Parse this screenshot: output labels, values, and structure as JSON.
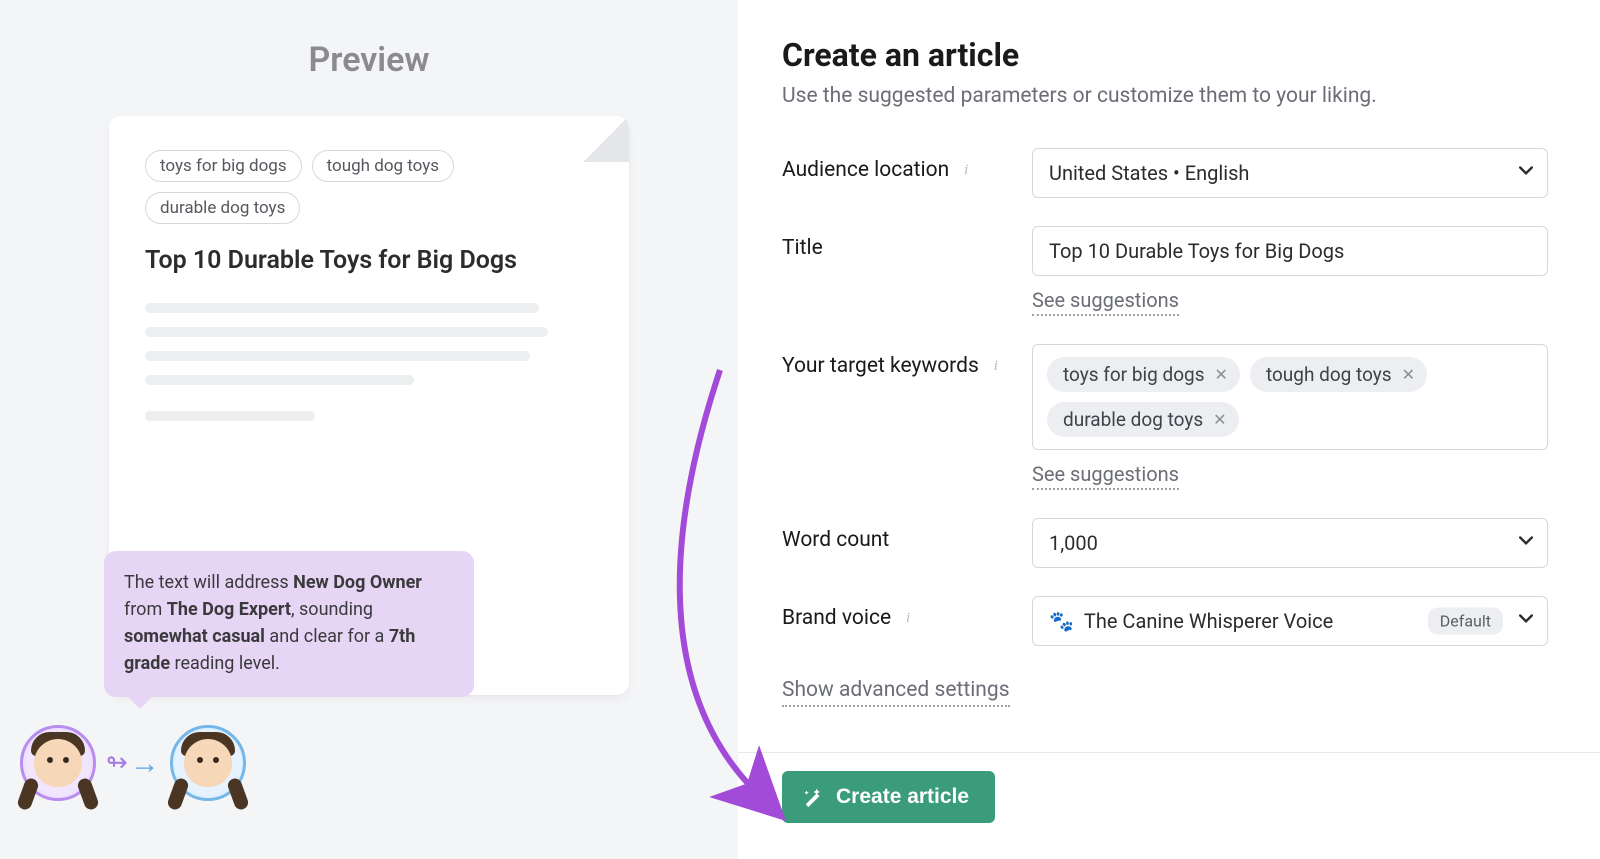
{
  "preview": {
    "heading": "Preview",
    "tags": [
      "toys for big dogs",
      "tough dog toys",
      "durable dog toys"
    ],
    "article_title": "Top 10 Durable Toys for Big Dogs",
    "callout": {
      "pre": "The text will address ",
      "audience": "New Dog Owner",
      "from": " from ",
      "brand": "The Dog Expert",
      "mid": ", sounding ",
      "tone": "somewhat casual",
      "post1": " and clear for a ",
      "grade": "7th grade",
      "post2": " reading level."
    }
  },
  "form": {
    "title": "Create an article",
    "subtitle": "Use the suggested parameters or customize them to your liking.",
    "audience": {
      "label": "Audience location",
      "value": "United States • English"
    },
    "title_field": {
      "label": "Title",
      "value": "Top 10 Durable Toys for Big Dogs",
      "suggestions": "See suggestions"
    },
    "keywords": {
      "label": "Your target keywords",
      "items": [
        "toys for big dogs",
        "tough dog toys",
        "durable dog toys"
      ],
      "suggestions": "See suggestions"
    },
    "word_count": {
      "label": "Word count",
      "value": "1,000"
    },
    "brand_voice": {
      "label": "Brand voice",
      "value": "The Canine Whisperer Voice",
      "badge": "Default"
    },
    "advanced": "Show advanced settings",
    "submit": "Create article"
  },
  "colors": {
    "accent_green": "#3a9c7a",
    "lilac": "#e7d5f6",
    "purple_arrow": "#a24bd9"
  }
}
